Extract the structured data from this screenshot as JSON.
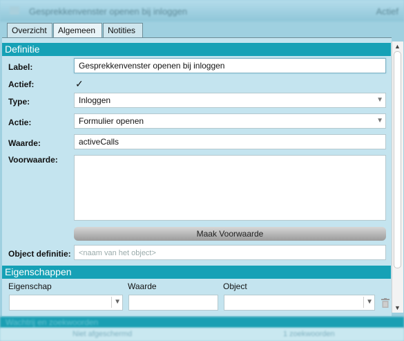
{
  "window": {
    "title": "Gesprekkenvenster openen bij inloggen",
    "right_label": "Actief"
  },
  "tabs": [
    {
      "label": "Overzicht"
    },
    {
      "label": "Algemeen"
    },
    {
      "label": "Notities"
    }
  ],
  "definitie": {
    "header": "Definitie",
    "label_label": "Label:",
    "label_value": "Gesprekkenvenster openen bij inloggen",
    "actief_label": "Actief:",
    "actief_check": "✓",
    "type_label": "Type:",
    "type_value": "Inloggen",
    "actie_label": "Actie:",
    "actie_value": "Formulier openen",
    "waarde_label": "Waarde:",
    "waarde_value": "activeCalls",
    "voorwaarde_label": "Voorwaarde:",
    "maak_button": "Maak Voorwaarde",
    "object_label": "Object definitie:",
    "object_placeholder": "<naam van het object>"
  },
  "eigenschappen": {
    "header": "Eigenschappen",
    "col_eigenschap": "Eigenschap",
    "col_waarde": "Waarde",
    "col_object": "Object"
  },
  "bottom": {
    "section": "Wachtrij en zoekwoorden",
    "left": "Niet afgeschermd",
    "right": "1 zoekwoorden"
  },
  "icons": {
    "dropdown": "▼",
    "scroll_up": "▲",
    "scroll_down": "▼"
  },
  "colors": {
    "section_header": "#16a1b6",
    "panel": "#c4e4ef",
    "button": "#b0b0b0"
  }
}
